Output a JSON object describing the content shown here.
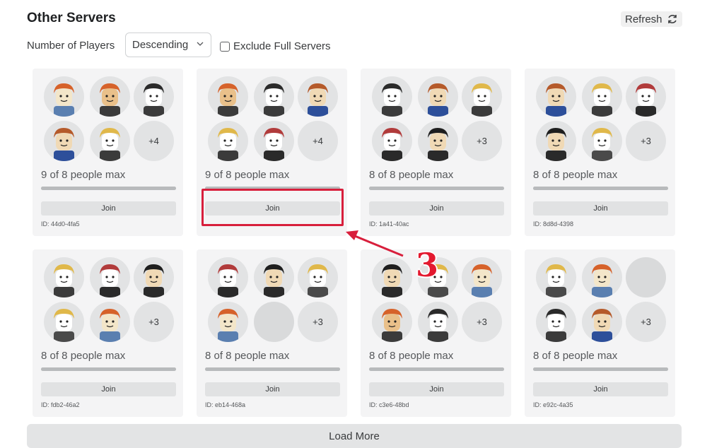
{
  "header": {
    "title": "Other Servers",
    "refresh_label": "Refresh"
  },
  "filters": {
    "sort_label": "Number of Players",
    "sort_selected": "Descending",
    "exclude_full_label": "Exclude Full Servers",
    "exclude_full_checked": false
  },
  "servers": [
    {
      "players_text": "9 of 8 people max",
      "more": "+4",
      "join_label": "Join",
      "id_text": "ID: 44d0-4fa5",
      "fill": 1.0
    },
    {
      "players_text": "9 of 8 people max",
      "more": "+4",
      "join_label": "Join",
      "id_text": "",
      "fill": 1.0
    },
    {
      "players_text": "8 of 8 people max",
      "more": "+3",
      "join_label": "Join",
      "id_text": "ID: 1a41-40ac",
      "fill": 1.0
    },
    {
      "players_text": "8 of 8 people max",
      "more": "+3",
      "join_label": "Join",
      "id_text": "ID: 8d8d-4398",
      "fill": 1.0
    },
    {
      "players_text": "8 of 8 people max",
      "more": "+3",
      "join_label": "Join",
      "id_text": "ID: fdb2-46a2",
      "fill": 1.0
    },
    {
      "players_text": "8 of 8 people max",
      "more": "+3",
      "join_label": "Join",
      "id_text": "ID: eb14-468a",
      "fill": 1.0
    },
    {
      "players_text": "8 of 8 people max",
      "more": "+3",
      "join_label": "Join",
      "id_text": "ID: c3e6-48bd",
      "fill": 1.0
    },
    {
      "players_text": "8 of 8 people max",
      "more": "+3",
      "join_label": "Join",
      "id_text": "ID: e92c-4a35",
      "fill": 1.0
    }
  ],
  "annotation": {
    "step_number": "3",
    "color": "#d81f3c"
  },
  "footer": {
    "load_more_label": "Load More"
  },
  "icons": {
    "refresh": "refresh-icon",
    "dropdown": "chevron-down-icon",
    "avatar": "avatar-icon"
  }
}
